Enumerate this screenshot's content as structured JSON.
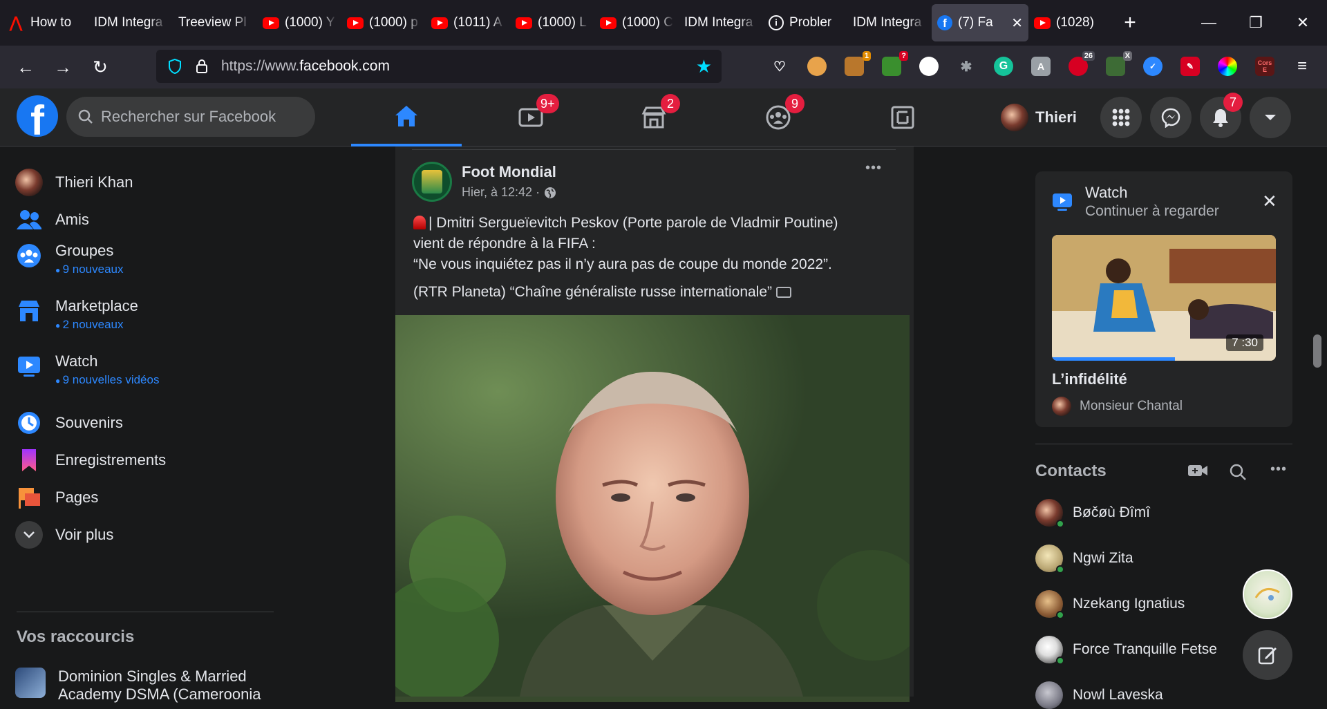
{
  "browser": {
    "tabs": [
      {
        "title": "How to",
        "icon": "adobe-icon"
      },
      {
        "title": "IDM Integra",
        "icon": "none"
      },
      {
        "title": "Treeview Pl",
        "icon": "none"
      },
      {
        "title": "(1000) Y",
        "icon": "youtube-icon"
      },
      {
        "title": "(1000) p",
        "icon": "youtube-icon"
      },
      {
        "title": "(1011) A",
        "icon": "youtube-icon"
      },
      {
        "title": "(1000) L",
        "icon": "youtube-icon"
      },
      {
        "title": "(1000) C",
        "icon": "youtube-icon"
      },
      {
        "title": "IDM Integra",
        "icon": "none"
      },
      {
        "title": "Probler",
        "icon": "info-icon"
      },
      {
        "title": "IDM Integra",
        "icon": "none"
      },
      {
        "title": "(7) Fa",
        "icon": "facebook-icon",
        "active": true
      },
      {
        "title": "(1028) ",
        "icon": "youtube-icon"
      }
    ],
    "new_tab": "+",
    "url_prefix": "https://www.",
    "url_domain": "facebook.com",
    "extension_badges": {
      "ext1": "1",
      "ext2": "?",
      "ext3": "26",
      "ext4": "X",
      "ext5": "Cors E"
    }
  },
  "fb": {
    "logo": "f",
    "search_placeholder": "Rechercher sur Facebook",
    "tabs": [
      {
        "name": "home",
        "badge": ""
      },
      {
        "name": "watch",
        "badge": "9+"
      },
      {
        "name": "marketplace",
        "badge": "2"
      },
      {
        "name": "groups",
        "badge": "9"
      },
      {
        "name": "gaming",
        "badge": ""
      }
    ],
    "user_first_name": "Thieri",
    "notifications_badge": "7"
  },
  "sidebar": {
    "items": [
      {
        "label": "Thieri Khan",
        "sub": ""
      },
      {
        "label": "Amis",
        "sub": ""
      },
      {
        "label": "Groupes",
        "sub": "9 nouveaux"
      },
      {
        "label": "Marketplace",
        "sub": "2 nouveaux"
      },
      {
        "label": "Watch",
        "sub": "9 nouvelles vidéos"
      },
      {
        "label": "Souvenirs",
        "sub": ""
      },
      {
        "label": "Enregistrements",
        "sub": ""
      },
      {
        "label": "Pages",
        "sub": ""
      },
      {
        "label": "Voir plus",
        "sub": ""
      }
    ],
    "shortcuts_title": "Vos raccourcis",
    "shortcut_1_line1": "Dominion Singles & Married",
    "shortcut_1_line2": "Academy DSMA (Cameroonia"
  },
  "post": {
    "page_name": "Foot Mondial",
    "time": "Hier, à 12:42 ·",
    "line1": "| Dmitri Sergueïevitch Peskov (Porte parole de Vladmir Poutine)",
    "line2": "vient de répondre à la FIFA :",
    "line3": "“Ne vous inquiétez pas il n’y aura pas de coupe du monde 2022”.",
    "line4": "(RTR Planeta) “Chaîne généraliste russe internationale”",
    "more": "•••"
  },
  "watch_panel": {
    "title": "Watch",
    "subtitle": "Continuer à regarder",
    "duration": "7 :30",
    "progress": 0.55,
    "video_title": "L’infidélité",
    "channel": "Monsieur Chantal"
  },
  "contacts": {
    "title": "Contacts",
    "list": [
      {
        "name": "Bøčøù Đîmî"
      },
      {
        "name": "Ngwi Zita"
      },
      {
        "name": "Nzekang Ignatius"
      },
      {
        "name": "Force Tranquille Fetse"
      },
      {
        "name": "Nowl Laveska"
      }
    ]
  },
  "colors": {
    "fb_blue": "#1877f2",
    "accent": "#2d88ff",
    "badge_red": "#e41e3f",
    "youtube_red": "#ff0000"
  }
}
